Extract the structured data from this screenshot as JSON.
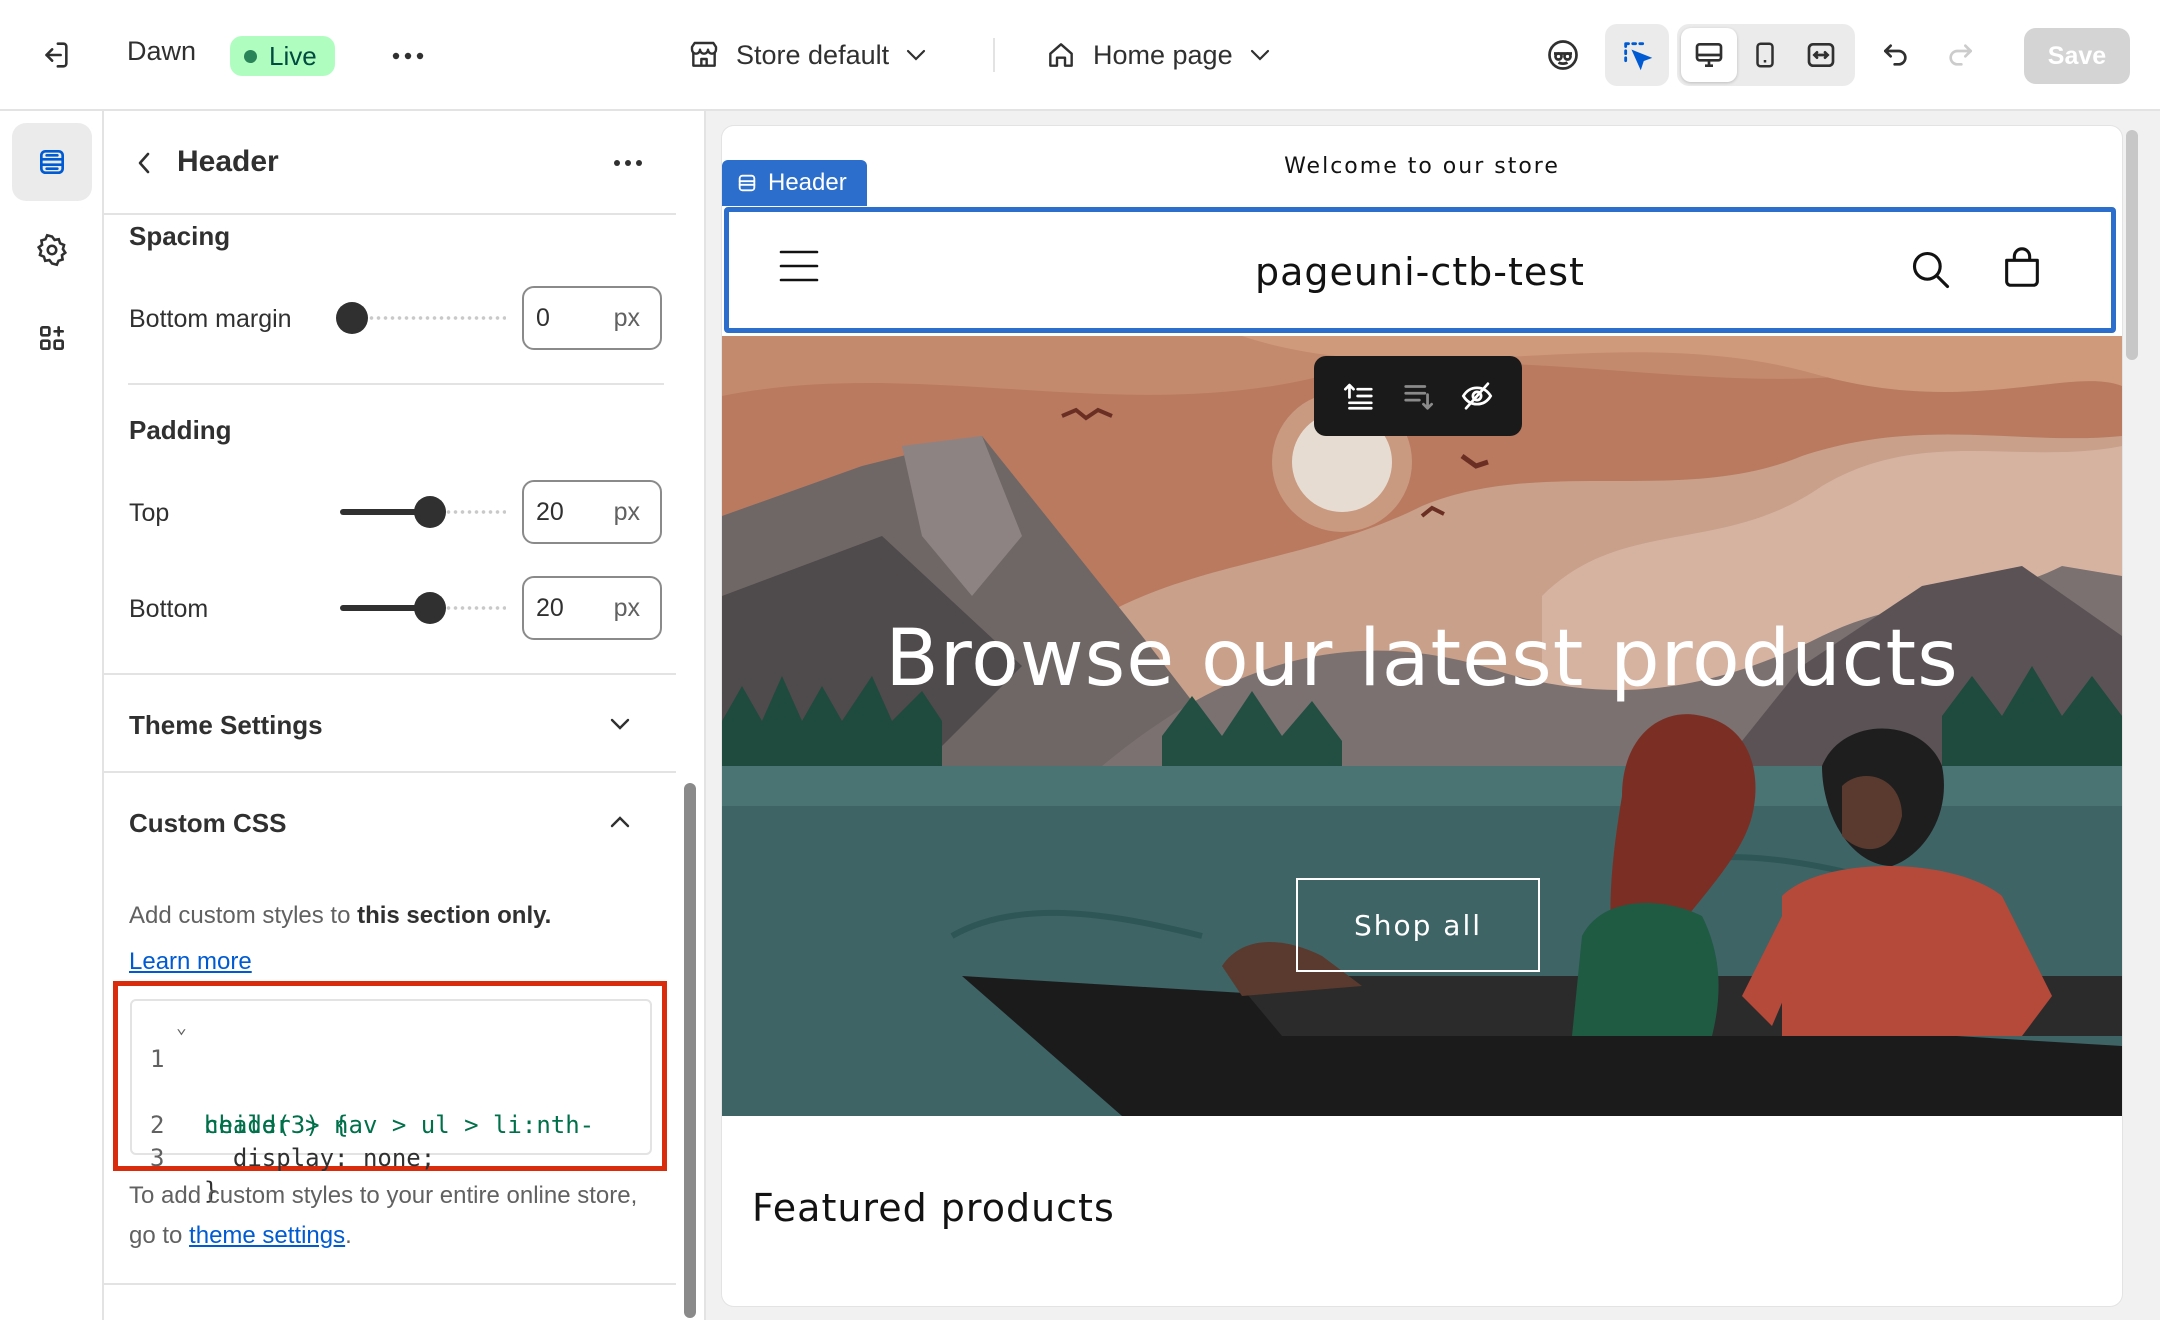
{
  "topbar": {
    "theme_name": "Dawn",
    "status_badge": "Live",
    "store_select": "Store default",
    "page_select": "Home page",
    "save_label": "Save"
  },
  "panel": {
    "title": "Header",
    "spacing": {
      "heading": "Spacing",
      "bottom_margin_label": "Bottom margin",
      "bottom_margin_value": "0",
      "bottom_margin_fraction": 0.0
    },
    "padding": {
      "heading": "Padding",
      "top_label": "Top",
      "top_value": "20",
      "top_fraction": 0.55,
      "bottom_label": "Bottom",
      "bottom_value": "20",
      "bottom_fraction": 0.55
    },
    "unit": "px",
    "theme_settings_label": "Theme Settings",
    "custom_css": {
      "heading": "Custom CSS",
      "desc_prefix": "Add custom styles to ",
      "desc_bold": "this section only.",
      "learn_more": "Learn more",
      "code_lines": [
        {
          "num": "1",
          "text": "header > nav > ul > li:nth-"
        },
        {
          "num": "",
          "text": "child(3) {"
        },
        {
          "num": "2",
          "text": "  display: none;"
        },
        {
          "num": "3",
          "text": "}"
        }
      ],
      "footer_prefix": "To add custom styles to your entire online store, go to ",
      "footer_link": "theme settings",
      "footer_suffix": "."
    }
  },
  "preview": {
    "announcement": "Welcome to our store",
    "section_badge": "Header",
    "store_name": "pageuni-ctb-test",
    "hero_title": "Browse our latest products",
    "hero_button": "Shop all",
    "featured_heading": "Featured products"
  },
  "colors": {
    "accent_blue": "#2c6ecb",
    "live_green": "#affebf",
    "highlight_red": "#d82c0d"
  },
  "icons": {
    "exit": "exit-icon",
    "store": "store-icon",
    "home": "home-icon",
    "accessibility": "accessibility-icon",
    "inspector": "inspector-icon",
    "desktop": "desktop-icon",
    "mobile": "mobile-icon",
    "fullwidth": "fullwidth-icon",
    "undo": "undo-icon",
    "redo": "redo-icon",
    "sections": "sections-icon",
    "settings": "gear-icon",
    "apps": "apps-icon"
  }
}
